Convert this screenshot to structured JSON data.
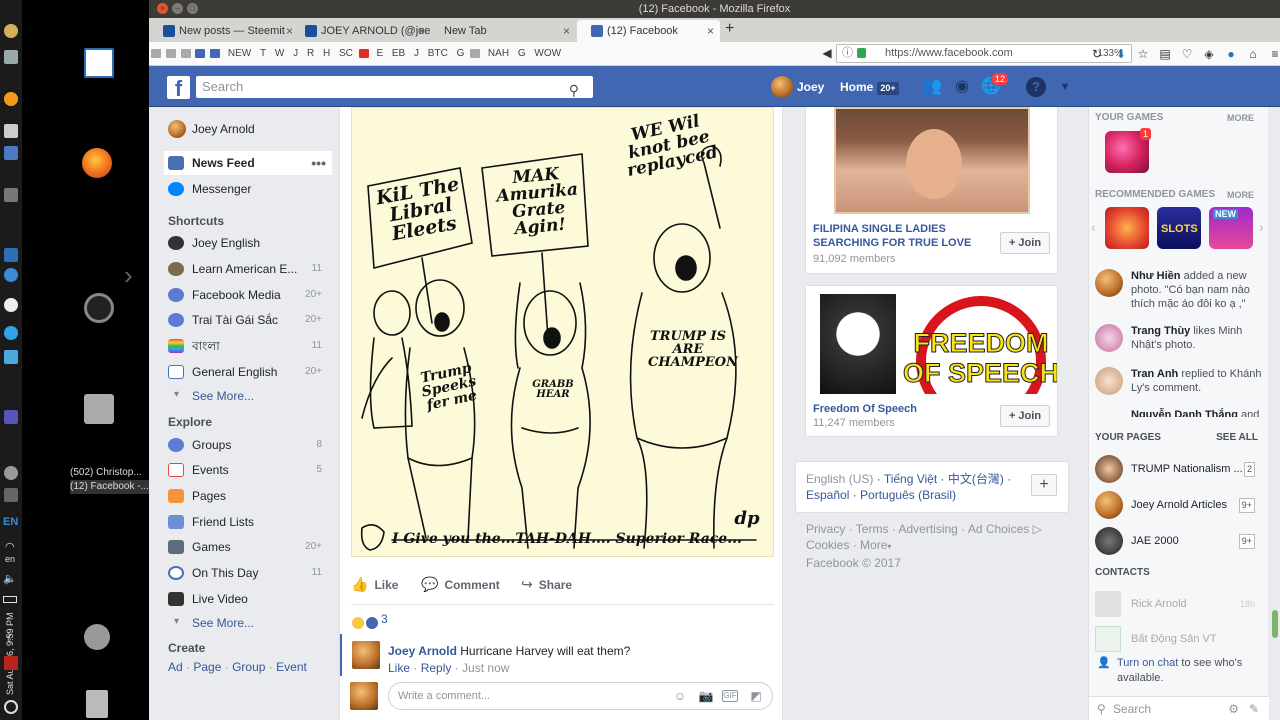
{
  "desktop": {
    "clock": "Sat Aug 26, 9:59 PM",
    "lang_indicator": "EN",
    "lang_sub": "en",
    "tasks": [
      "(502) Christop...",
      "(12) Facebook -..."
    ]
  },
  "window": {
    "title": "(12) Facebook - Mozilla Firefox"
  },
  "tabs": [
    {
      "label": "New posts — Steemit"
    },
    {
      "label": "JOEY ARNOLD (@joe..."
    },
    {
      "label": "New Tab"
    },
    {
      "label": "(12) Facebook"
    }
  ],
  "bookmarks": [
    "NEW",
    "T",
    "W",
    "J",
    "R",
    "H",
    "SC",
    "E",
    "EB",
    "J",
    "BTC",
    "G",
    "NAH",
    "G",
    "WOW"
  ],
  "urlbar": {
    "url": "https://www.facebook.com",
    "zoom": "133%"
  },
  "fb_header": {
    "search_placeholder": "Search",
    "user": "Joey",
    "home": "Home",
    "home_badge": "20+",
    "notifications": "12"
  },
  "left_nav": {
    "profile": "Joey Arnold",
    "news_feed": "News Feed",
    "messenger": "Messenger",
    "shortcuts_head": "Shortcuts",
    "shortcuts": [
      {
        "label": "Joey English",
        "count": ""
      },
      {
        "label": "Learn American E...",
        "count": "11"
      },
      {
        "label": "Facebook Media",
        "count": "20+"
      },
      {
        "label": "Trai Tài Gái Sắc",
        "count": "20+"
      },
      {
        "label": "বাংলা",
        "count": "11"
      },
      {
        "label": "General English",
        "count": "20+"
      }
    ],
    "see_more": "See More...",
    "explore_head": "Explore",
    "explore": [
      {
        "label": "Groups",
        "count": "8"
      },
      {
        "label": "Events",
        "count": "5"
      },
      {
        "label": "Pages",
        "count": ""
      },
      {
        "label": "Friend Lists",
        "count": ""
      },
      {
        "label": "Games",
        "count": "20+"
      },
      {
        "label": "On This Day",
        "count": "11"
      },
      {
        "label": "Live Video",
        "count": ""
      }
    ],
    "see_more2": "See More...",
    "create_head": "Create",
    "create_links": [
      "Ad",
      "Page",
      "Group",
      "Event"
    ]
  },
  "post": {
    "cartoon": {
      "sign1": "KiL The Libral Eleets",
      "sign2": "MAK Amurika Grate Agin!",
      "sign3": "WE Wil knot bee replayced",
      "shirt1": "Trump Speeks fer me",
      "shirt2": "GRABB HEAR",
      "shirt3": "TRUMP IS ARE CHAMPEON",
      "caption": "I Give you the...TAH-DAH.... Superior Race...",
      "signature": "dp"
    },
    "actions": {
      "like": "Like",
      "comment": "Comment",
      "share": "Share"
    },
    "reaction_count": "3",
    "comment": {
      "author": "Joey Arnold",
      "text": "Hurricane Harvey will eat them?",
      "like": "Like",
      "reply": "Reply",
      "time": "Just now"
    },
    "write_placeholder": "Write a comment..."
  },
  "groups": [
    {
      "name": "FILIPINA SINGLE LADIES SEARCHING FOR TRUE LOVE",
      "members": "91,092 members",
      "join": "Join"
    },
    {
      "name": "Freedom Of Speech",
      "members": "11,247 members",
      "join": "Join",
      "image_text": "FREEDOM OF SPEECH"
    }
  ],
  "languages": {
    "current": "English (US)",
    "others": [
      "Tiếng Việt",
      "中文(台灣)",
      "Español",
      "Português (Brasil)"
    ]
  },
  "footer": {
    "links": [
      "Privacy",
      "Terms",
      "Advertising",
      "Ad Choices",
      "Cookies",
      "More"
    ],
    "copyright": "Facebook © 2017"
  },
  "right_rail": {
    "your_games": "YOUR GAMES",
    "more": "MORE",
    "game_badge": "1",
    "recommended": "RECOMMENDED GAMES",
    "more2": "MORE",
    "game_labels": [
      "SLOTS",
      "NEW"
    ],
    "activity": [
      {
        "name": "Như Hiền",
        "text": "added a new photo. \"Có bạn nam nào thích mặc áo đôi ko ạ ,\""
      },
      {
        "name": "Trang Thùy",
        "text": "likes Minh Nhật's photo."
      },
      {
        "name": "Tran Anh",
        "text": "replied to Khánh Ly's comment."
      },
      {
        "name": "Nguyễn Danh Thắng",
        "text": "and"
      }
    ],
    "your_pages": "YOUR PAGES",
    "see_all": "SEE ALL",
    "pages": [
      {
        "name": "TRUMP Nationalism ...",
        "count": "2"
      },
      {
        "name": "Joey Arnold Articles",
        "count": "9+"
      },
      {
        "name": "JAE 2000",
        "count": "9+"
      }
    ],
    "contacts_head": "CONTACTS",
    "contacts": [
      {
        "name": "Rick Arnold",
        "time": "18h"
      },
      {
        "name": "Bất Động Sản VT",
        "time": ""
      }
    ],
    "turn_on_link": "Turn on chat",
    "turn_on_rest": "to see who's available.",
    "search": "Search"
  }
}
